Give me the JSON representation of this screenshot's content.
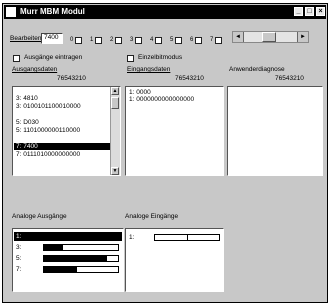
{
  "window": {
    "title": "Murr MBM Modul"
  },
  "toolbar": {
    "edit_label": "Bearbeiten",
    "edit_value": "7400",
    "bit_labels": [
      "0",
      "1",
      "2",
      "3",
      "4",
      "5",
      "6",
      "7"
    ]
  },
  "options": {
    "insert_outputs_label": "Ausgänge eintragen",
    "single_bit_label": "Einzelbitmodus"
  },
  "output_data": {
    "title": "Ausgangsdaten",
    "header": "76543210",
    "rows": [
      "3:    4810",
      "3:    0100101100010000",
      "",
      "5:    D030",
      "5:    1101000000110000",
      "",
      "7:    7400",
      "7:    0111010000000000"
    ],
    "selected_row": 6
  },
  "input_data": {
    "title": "Eingangsdaten",
    "header": "76543210",
    "rows": [
      "1:    0000",
      "1:    0000000000000000"
    ]
  },
  "diagnosis": {
    "title": "Anwenderdiagnose",
    "header": "76543210"
  },
  "analog_outputs": {
    "title": "Analoge Ausgänge",
    "rows": [
      {
        "label": "1:",
        "value": 1.0,
        "selected": true
      },
      {
        "label": "3:",
        "value": 0.25
      },
      {
        "label": "5:",
        "value": 0.85
      },
      {
        "label": "7:",
        "value": 0.45
      }
    ]
  },
  "analog_inputs": {
    "title": "Analoge Eingänge",
    "rows": [
      {
        "label": "1:",
        "value": 0.0
      }
    ]
  }
}
